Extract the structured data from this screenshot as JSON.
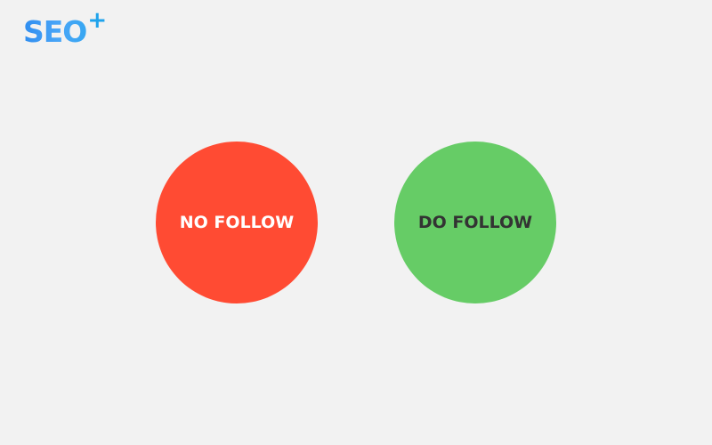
{
  "logo": {
    "text": "SEO",
    "plus": "+",
    "plus_color": "#1fa3ec"
  },
  "circles": [
    {
      "label": "NO FOLLOW",
      "color": "#ff4b33",
      "text_color": "#ffffff"
    },
    {
      "label": "DO FOLLOW",
      "color": "#66cc66",
      "text_color": "#333333"
    }
  ]
}
